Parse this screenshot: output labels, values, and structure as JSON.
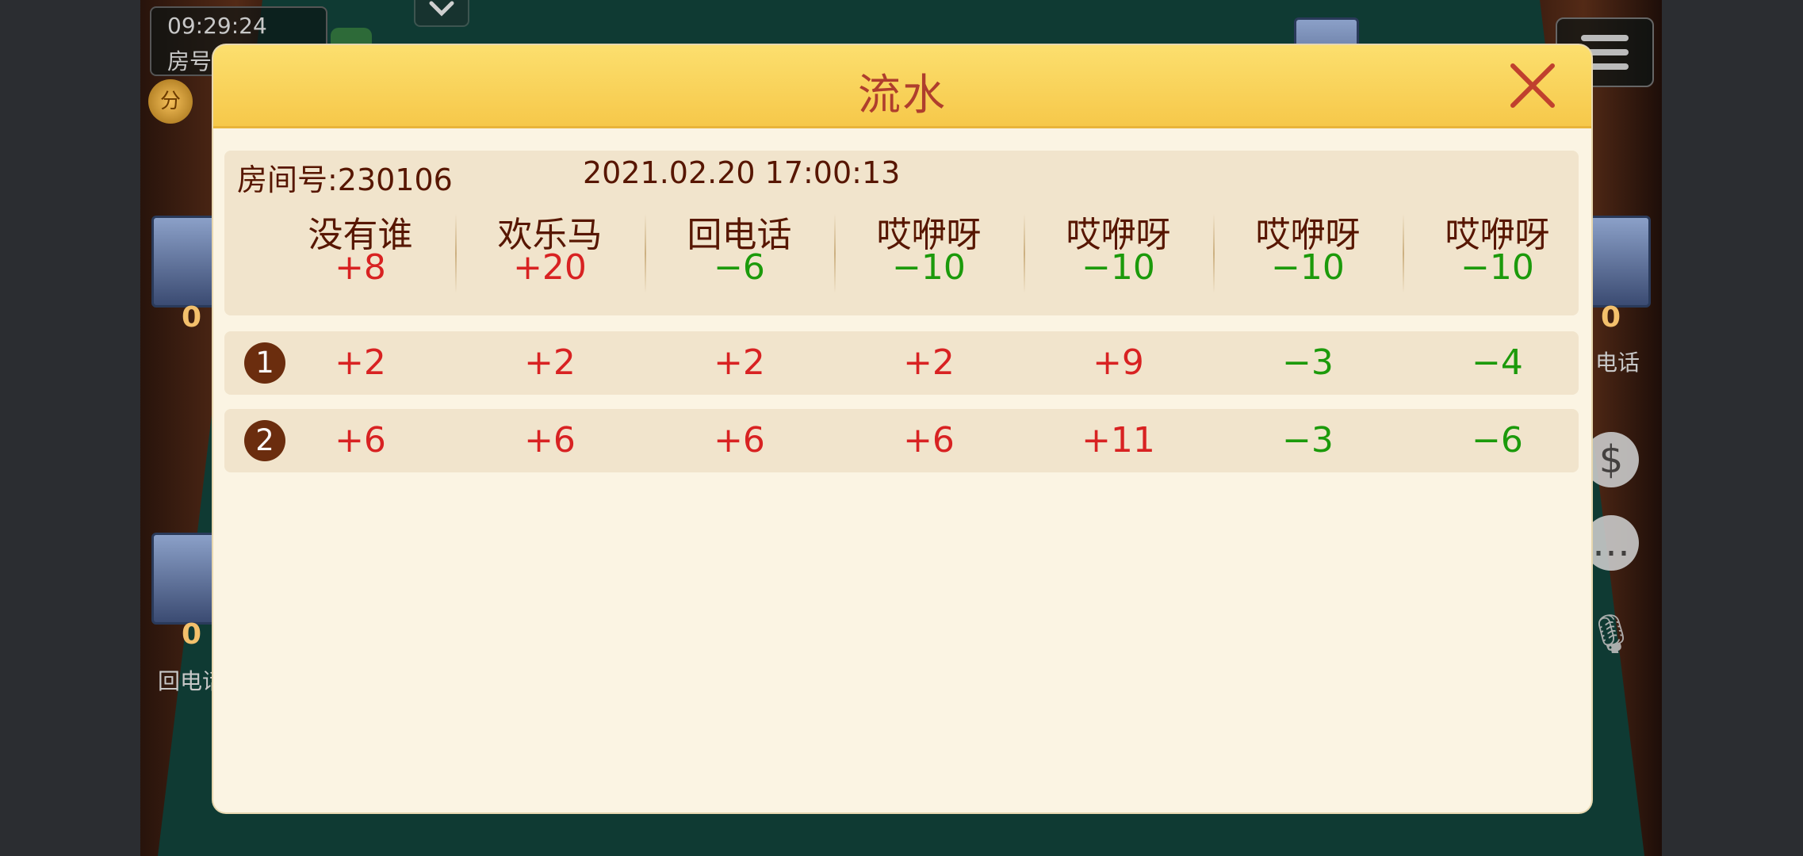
{
  "background": {
    "clock": "09:29:24",
    "room_label": "房号",
    "score_badge": "分",
    "seats": [
      {
        "score": "0",
        "name": ""
      },
      {
        "score": "0",
        "name": "电话"
      },
      {
        "score": "0",
        "name": "回电话"
      }
    ]
  },
  "dialog": {
    "title": "流水",
    "room_number": "房间号:230106",
    "datetime": "2021.02.20  17:00:13",
    "players": [
      {
        "name": "没有谁",
        "total": "+8"
      },
      {
        "name": "欢乐马",
        "total": "+20"
      },
      {
        "name": "回电话",
        "total": "−6"
      },
      {
        "name": "哎咿呀",
        "total": "−10"
      },
      {
        "name": "哎咿呀",
        "total": "−10"
      },
      {
        "name": "哎咿呀",
        "total": "−10"
      },
      {
        "name": "哎咿呀",
        "total": "−10"
      }
    ],
    "rounds": [
      {
        "number": "1",
        "scores": [
          "+2",
          "+2",
          "+2",
          "+2",
          "+9",
          "−3",
          "−4"
        ]
      },
      {
        "number": "2",
        "scores": [
          "+6",
          "+6",
          "+6",
          "+6",
          "+11",
          "−3",
          "−6"
        ]
      }
    ]
  },
  "colors": {
    "title": "#af3e2d",
    "text_brown": "#571600",
    "positive": "#d82222",
    "negative": "#1c9a0b"
  }
}
